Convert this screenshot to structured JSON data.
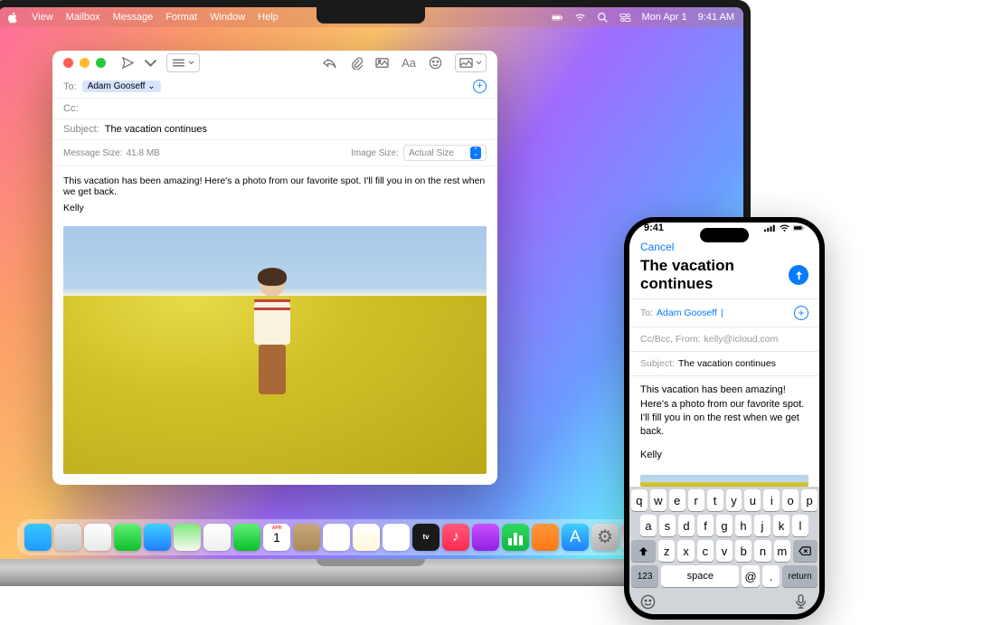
{
  "menubar": {
    "items": [
      "View",
      "Mailbox",
      "Message",
      "Format",
      "Window",
      "Help"
    ],
    "date": "Mon Apr 1",
    "time": "9:41 AM"
  },
  "mail": {
    "to_label": "To:",
    "to_chip": "Adam Gooseff ⌄",
    "cc_label": "Cc:",
    "subject_label": "Subject:",
    "subject": "The vacation continues",
    "msg_size_label": "Message Size:",
    "msg_size": "41.8 MB",
    "img_size_label": "Image Size:",
    "img_size_value": "Actual Size",
    "body": "This vacation has been amazing! Here's a photo from our favorite spot. I'll fill you in on the rest when we get back.",
    "signature": "Kelly"
  },
  "dock": {
    "icons": [
      {
        "name": "finder",
        "bg": "linear-gradient(#37c6ff,#1e9bff)"
      },
      {
        "name": "launchpad",
        "bg": "linear-gradient(#e8e8e8,#c8c8c8)"
      },
      {
        "name": "safari",
        "bg": "linear-gradient(#fff,#e8e8e8)"
      },
      {
        "name": "messages",
        "bg": "linear-gradient(#5ef075,#0dbf2c)"
      },
      {
        "name": "mail",
        "bg": "linear-gradient(#3fcfff,#1e7fff)"
      },
      {
        "name": "maps",
        "bg": "linear-gradient(#7de87d,#f8f8f0)"
      },
      {
        "name": "photos",
        "bg": "linear-gradient(#fff,#f0f0f0)"
      },
      {
        "name": "facetime",
        "bg": "linear-gradient(#5ef075,#0dbf2c)"
      },
      {
        "name": "calendar",
        "bg": "#fff"
      },
      {
        "name": "contacts",
        "bg": "linear-gradient(#c8a878,#a88858)"
      },
      {
        "name": "reminders",
        "bg": "#fff"
      },
      {
        "name": "notes",
        "bg": "linear-gradient(#fff,#fff8d8)"
      },
      {
        "name": "freeform",
        "bg": "#fff"
      },
      {
        "name": "tv",
        "bg": "#1a1a1a"
      },
      {
        "name": "music",
        "bg": "linear-gradient(#ff5a78,#ff2850)"
      },
      {
        "name": "podcasts",
        "bg": "linear-gradient(#c850ff,#9020e0)"
      },
      {
        "name": "numbers",
        "bg": "linear-gradient(#30d860,#10b840)"
      },
      {
        "name": "pages",
        "bg": "linear-gradient(#ff9838,#ff7818)"
      },
      {
        "name": "appstore",
        "bg": "linear-gradient(#3fcfff,#1e7fff)"
      },
      {
        "name": "settings",
        "bg": "linear-gradient(#e0e0e0,#b8b8b8)"
      },
      {
        "name": "iphone-mirror",
        "bg": "linear-gradient(#ffa0c0,#c8ffe8)"
      }
    ],
    "right": [
      {
        "name": "downloads",
        "bg": "linear-gradient(#40c8ff,#2090e0)"
      },
      {
        "name": "trash",
        "bg": "linear-gradient(#e0e0e0,#b8b8b8)"
      }
    ],
    "cal_date": "1",
    "cal_month": "APR"
  },
  "iphone": {
    "time": "9:41",
    "cancel": "Cancel",
    "title": "The vacation continues",
    "to_label": "To:",
    "to_value": "Adam Gooseff",
    "cc_label": "Cc/Bcc, From:",
    "from_email": "kelly@icloud.com",
    "subject_label": "Subject:",
    "subject": "The vacation continues",
    "body": "This vacation has been amazing! Here's a photo from our favorite spot. I'll fill you in on the rest when we get back.",
    "signature": "Kelly",
    "keyboard": {
      "row1": [
        "q",
        "w",
        "e",
        "r",
        "t",
        "y",
        "u",
        "i",
        "o",
        "p"
      ],
      "row2": [
        "a",
        "s",
        "d",
        "f",
        "g",
        "h",
        "j",
        "k",
        "l"
      ],
      "row3": [
        "z",
        "x",
        "c",
        "v",
        "b",
        "n",
        "m"
      ],
      "num": "123",
      "space": "space",
      "at": "@",
      "dot": ".",
      "return": "return"
    }
  }
}
